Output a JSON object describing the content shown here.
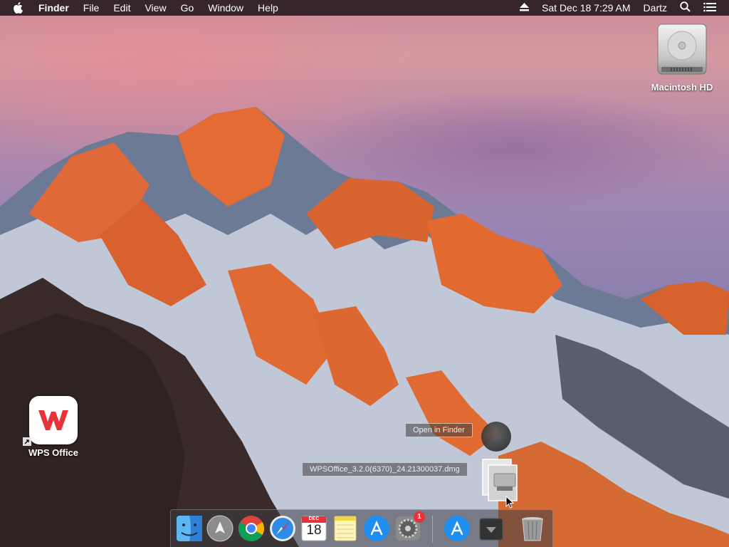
{
  "menubar": {
    "app_name": "Finder",
    "items": [
      "File",
      "Edit",
      "View",
      "Go",
      "Window",
      "Help"
    ],
    "clock": "Sat Dec 18  7:29 AM",
    "user": "Dartz"
  },
  "desktop": {
    "drive_label": "Macintosh HD",
    "app_label": "WPS Office"
  },
  "drag": {
    "open_hint": "Open in Finder",
    "filename": "WPSOffice_3.2.0(6370)_24.21300037.dmg"
  },
  "dock": {
    "calendar_month": "DEC",
    "calendar_day": "18",
    "settings_badge": "1"
  },
  "colors": {
    "menubar": "#281c22",
    "wps_red": "#e8323a",
    "badge": "#e8323a"
  }
}
